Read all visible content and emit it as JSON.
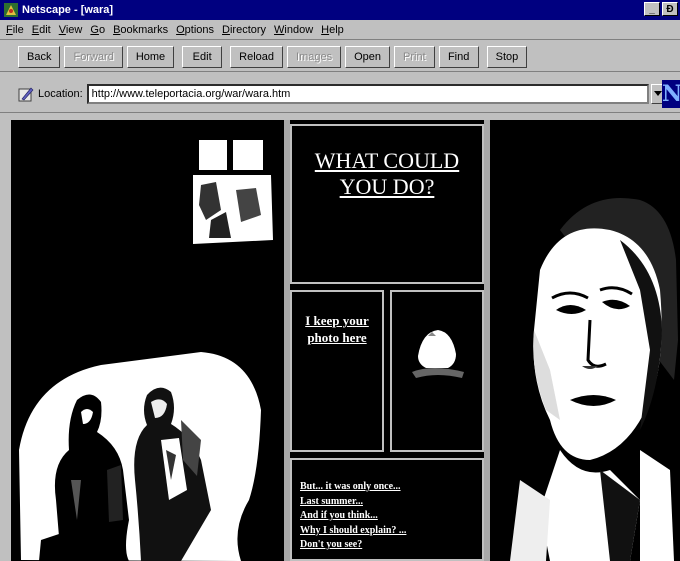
{
  "window": {
    "title": "Netscape - [wara]",
    "minimize_label": "_",
    "restore_label": "Ɖ"
  },
  "menubar": {
    "items": [
      {
        "accel": "F",
        "rest": "ile"
      },
      {
        "accel": "E",
        "rest": "dit"
      },
      {
        "accel": "V",
        "rest": "iew"
      },
      {
        "accel": "G",
        "rest": "o"
      },
      {
        "accel": "B",
        "rest": "ookmarks"
      },
      {
        "accel": "O",
        "rest": "ptions"
      },
      {
        "accel": "D",
        "rest": "irectory"
      },
      {
        "accel": "W",
        "rest": "indow"
      },
      {
        "accel": "H",
        "rest": "elp"
      }
    ]
  },
  "toolbar": {
    "back": "Back",
    "forward": "Forward",
    "home": "Home",
    "edit": "Edit",
    "reload": "Reload",
    "images": "Images",
    "open": "Open",
    "print": "Print",
    "find": "Find",
    "stop": "Stop"
  },
  "location": {
    "label": "Location:",
    "url": "http://www.teleportacia.org/war/wara.htm",
    "logo_letter": "N"
  },
  "page": {
    "heading_link": "WHAT COULD YOU DO?",
    "photo_link": "I keep your photo here",
    "story_links": [
      "But... it was only once...",
      "Last summer...",
      "And if you think...",
      "Why I should explain? ...",
      "Don't you see?"
    ]
  },
  "colors": {
    "title_bar": "#000080",
    "chrome": "#c0c0c0",
    "page_background": "#000000",
    "link_text": "#ffffff"
  },
  "icons": {
    "app": "netscape-app-icon",
    "location": "bookmark-quill-icon",
    "dropdown": "triangle-down-icon"
  }
}
